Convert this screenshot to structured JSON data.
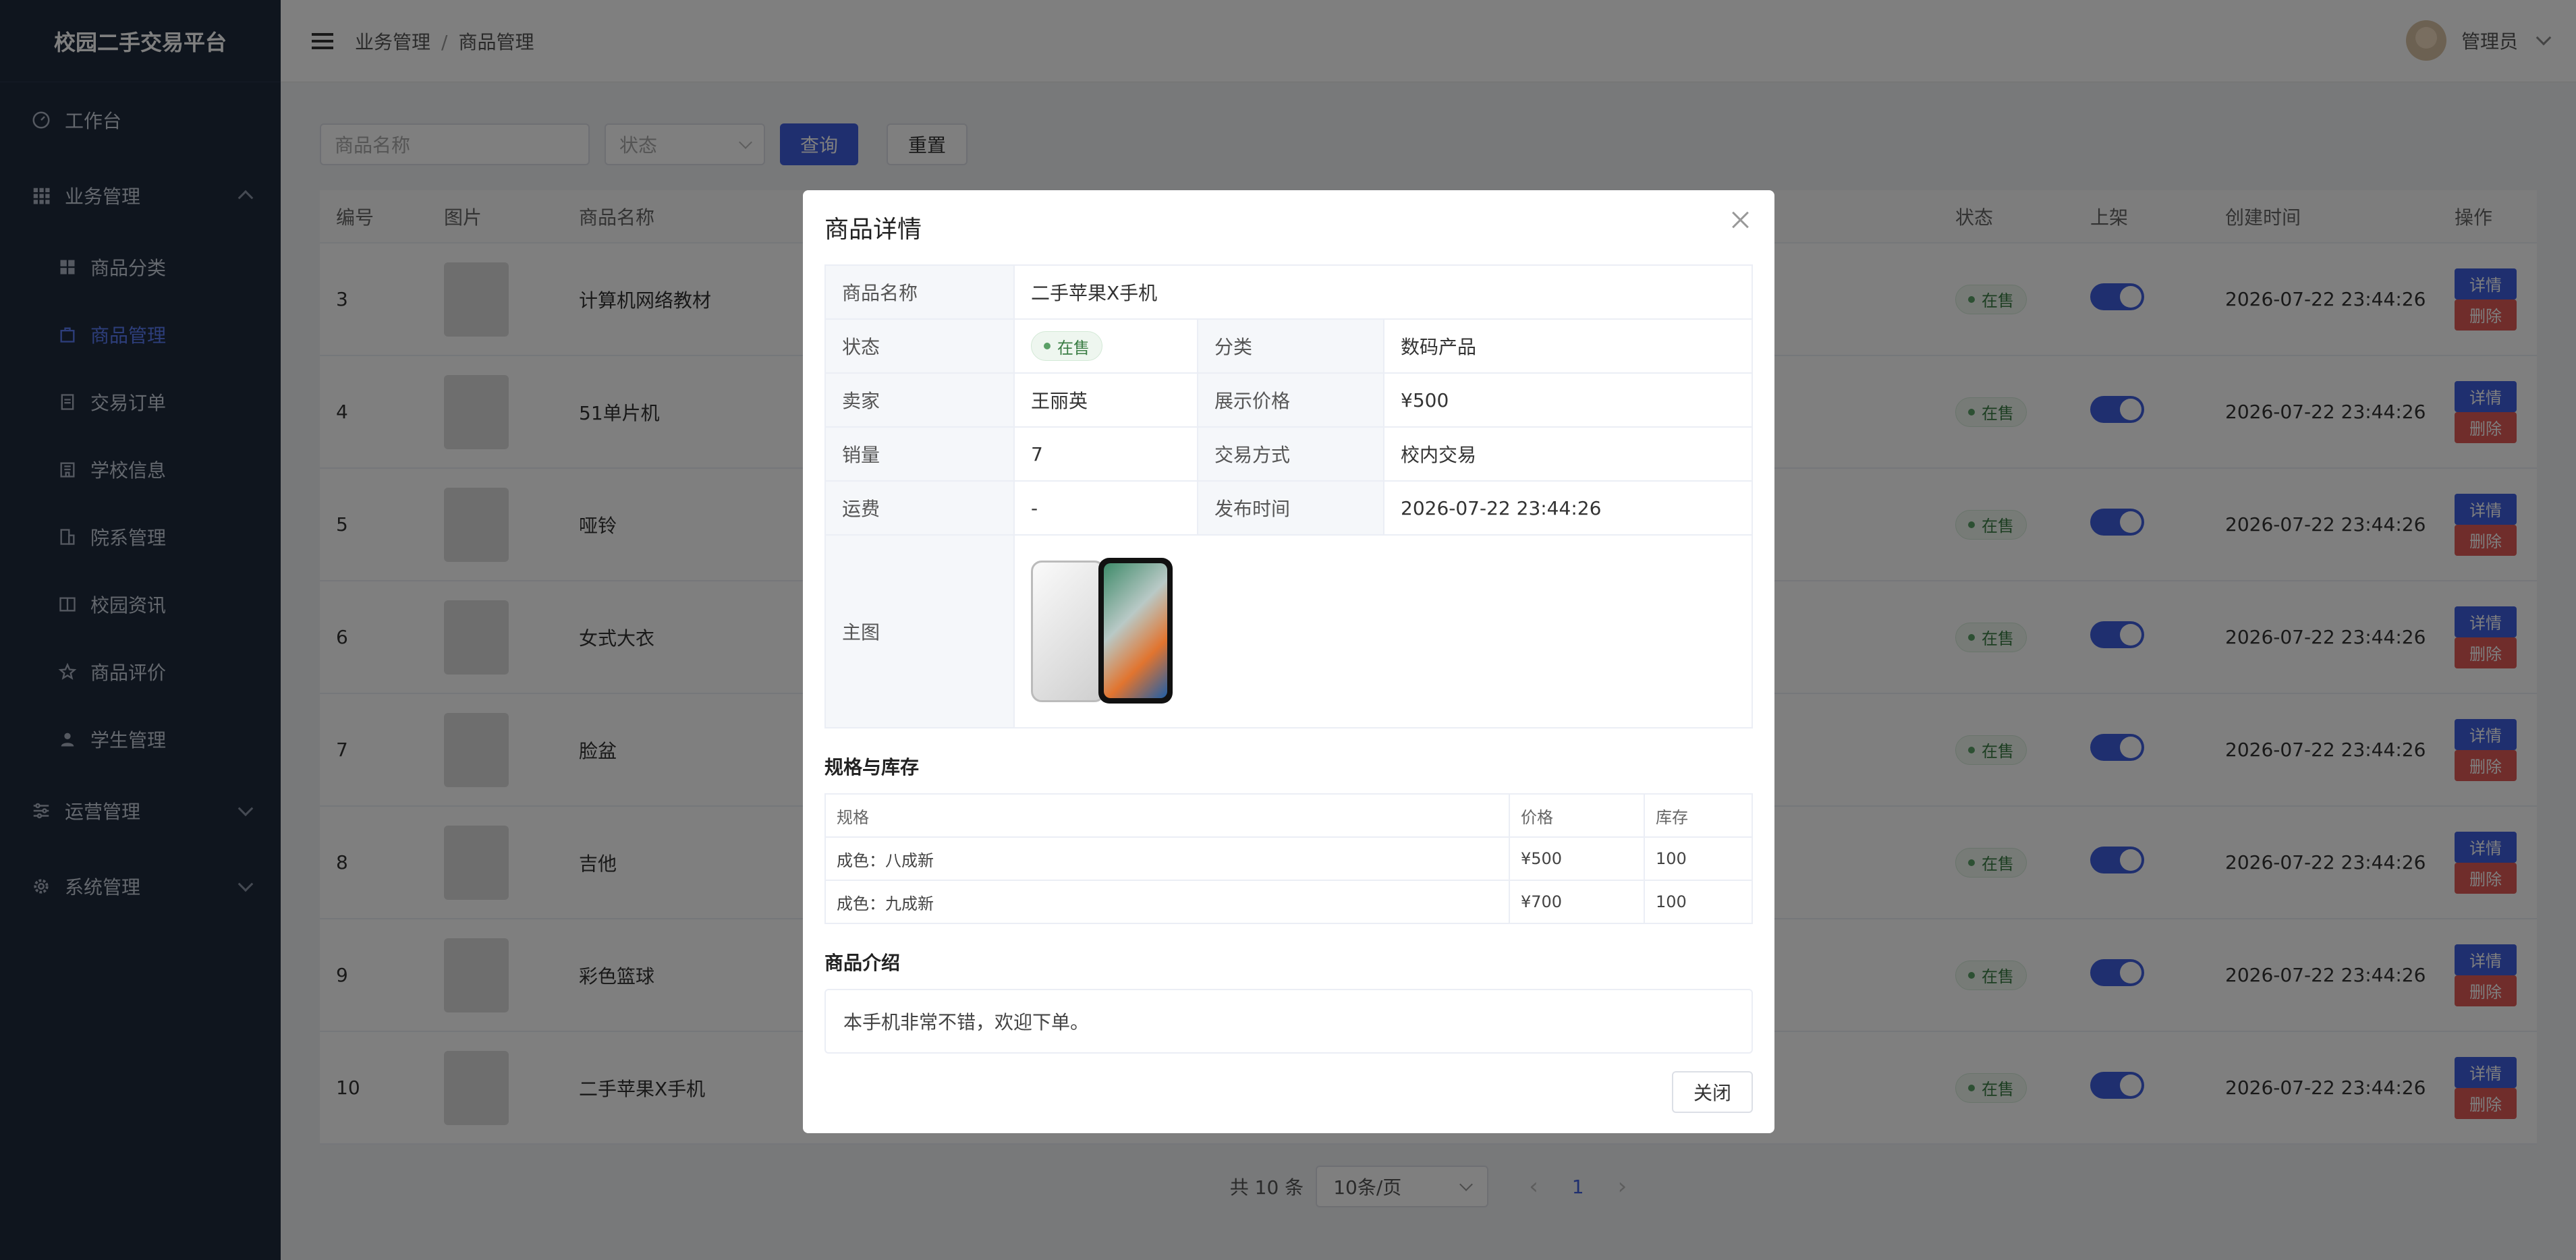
{
  "app": {
    "title": "校园二手交易平台"
  },
  "sidebar": {
    "workbench": "工作台",
    "business": "业务管理",
    "business_items": [
      "商品分类",
      "商品管理",
      "交易订单",
      "学校信息",
      "院系管理",
      "校园资讯",
      "商品评价",
      "学生管理"
    ],
    "operations": "运营管理",
    "system": "系统管理"
  },
  "header": {
    "crumb1": "业务管理",
    "sep": "/",
    "crumb2": "商品管理",
    "user": "管理员"
  },
  "filters": {
    "name_placeholder": "商品名称",
    "status_placeholder": "状态",
    "query": "查询",
    "reset": "重置"
  },
  "table": {
    "headers": {
      "id": "编号",
      "image": "图片",
      "name": "商品名称",
      "status": "状态",
      "listed": "上架",
      "created": "创建时间",
      "ops": "操作"
    },
    "rows": [
      {
        "id": "3",
        "name": "计算机网络教材",
        "status": "在售",
        "listed": true,
        "created": "2026-07-22 23:44:26"
      },
      {
        "id": "4",
        "name": "51单片机",
        "status": "在售",
        "listed": true,
        "created": "2026-07-22 23:44:26"
      },
      {
        "id": "5",
        "name": "哑铃",
        "status": "在售",
        "listed": true,
        "created": "2026-07-22 23:44:26"
      },
      {
        "id": "6",
        "name": "女式大衣",
        "status": "在售",
        "listed": true,
        "created": "2026-07-22 23:44:26"
      },
      {
        "id": "7",
        "name": "脸盆",
        "status": "在售",
        "listed": true,
        "created": "2026-07-22 23:44:26"
      },
      {
        "id": "8",
        "name": "吉他",
        "status": "在售",
        "listed": true,
        "created": "2026-07-22 23:44:26"
      },
      {
        "id": "9",
        "name": "彩色篮球",
        "status": "在售",
        "listed": true,
        "created": "2026-07-22 23:44:26"
      },
      {
        "id": "10",
        "name": "二手苹果X手机",
        "status": "在售",
        "listed": true,
        "created": "2026-07-22 23:44:26"
      }
    ],
    "detail_label": "详情",
    "delete_label": "删除"
  },
  "pager": {
    "total": "共 10 条",
    "page_size": "10条/页",
    "prev": "‹",
    "current": "1",
    "next": "›"
  },
  "modal": {
    "title": "商品详情",
    "labels": {
      "name": "商品名称",
      "status": "状态",
      "category": "分类",
      "seller": "卖家",
      "price": "展示价格",
      "sales": "销量",
      "trade": "交易方式",
      "shipping": "运费",
      "published": "发布时间",
      "image": "主图"
    },
    "values": {
      "name": "二手苹果X手机",
      "status": "在售",
      "category": "数码产品",
      "seller": "王丽英",
      "price": "¥500",
      "sales": "7",
      "trade": "校内交易",
      "shipping": "-",
      "published": "2026-07-22 23:44:26"
    },
    "spec_title": "规格与库存",
    "spec_headers": [
      "规格",
      "价格",
      "库存"
    ],
    "spec_rows": [
      [
        "成色：八成新",
        "¥500",
        "100"
      ],
      [
        "成色：九成新",
        "¥700",
        "100"
      ]
    ],
    "intro_title": "商品介绍",
    "intro": "本手机非常不错，欢迎下单。",
    "close": "关闭"
  },
  "colors": {
    "sidebar_bg": "#1f2a3d",
    "primary": "#3f5ede",
    "danger": "#e05b56",
    "on_sale": "#3a7d44"
  }
}
